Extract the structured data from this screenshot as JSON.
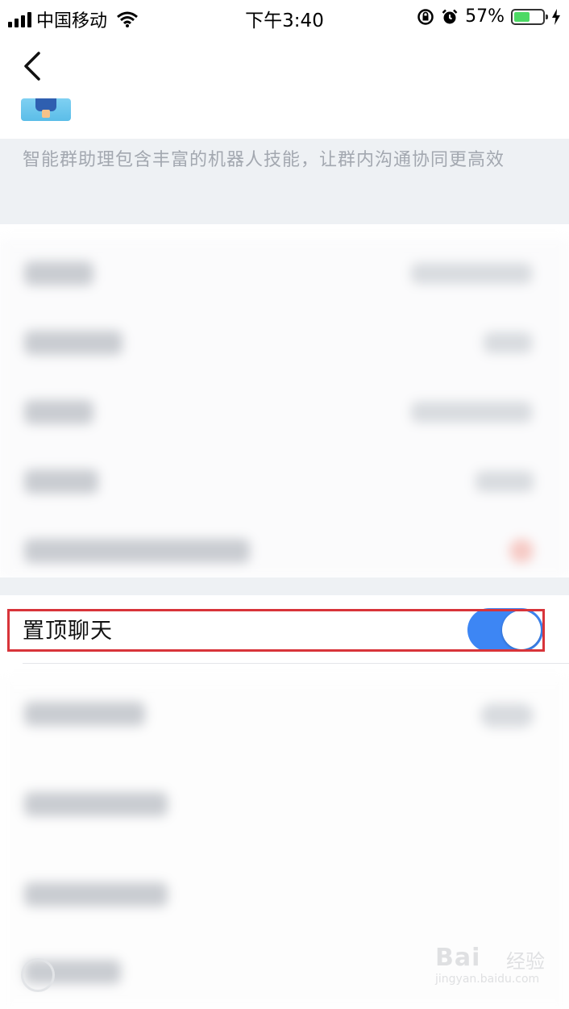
{
  "status_bar": {
    "carrier": "中国移动",
    "time": "下午3:40",
    "battery_percent": "57%",
    "battery_level": 0.57
  },
  "assistant": {
    "description": "智能群助理包含丰富的机器人技能，让群内沟通协同更高效"
  },
  "pinned_chat": {
    "label": "置顶聊天",
    "enabled": true
  },
  "watermark": {
    "brand": "Bai",
    "suffix": "经验",
    "url": "jingyan.baidu.com"
  },
  "colors": {
    "toggle_on": "#3d86f4",
    "highlight": "#d8343a",
    "section_bg": "#eef1f4",
    "desc_text": "#a3a8b0"
  }
}
